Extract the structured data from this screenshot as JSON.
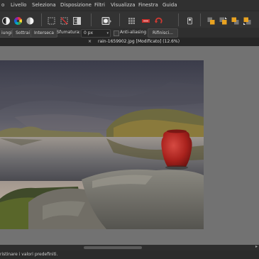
{
  "menu": {
    "partial_first": "o",
    "items": [
      "Livello",
      "Seleziona",
      "Disposizione",
      "Filtri",
      "Visualizza",
      "Finestra",
      "Guida"
    ]
  },
  "toolbar": {
    "icons": [
      "brightness-icon",
      "color-wheel-icon",
      "white-balance-icon",
      "marquee-icon",
      "no-selection-icon",
      "invert-selection-icon",
      "layer-mask-icon",
      "grid-icon",
      "snapping-icon",
      "undo-redo-icon",
      "mask-icon",
      "arrange-front-icon",
      "arrange-forward-icon",
      "arrange-backward-icon",
      "arrange-back-icon"
    ]
  },
  "context": {
    "add_label": "iungi",
    "subtract_label": "Sottrai",
    "intersect_label": "Interseca",
    "feather_label": "Sfumatura:",
    "feather_value": "0 px",
    "antialias_label": "Anti-aliasing",
    "refine_label": "Rifinisci..."
  },
  "tab": {
    "title": "rain-1659902.jpg [Modificato] (12.6%)",
    "close_glyph": "×"
  },
  "status": {
    "text": "ristinare i valori predefiniti."
  },
  "colors": {
    "accent_red": "#c8302c",
    "workspace_gray": "#727272"
  }
}
